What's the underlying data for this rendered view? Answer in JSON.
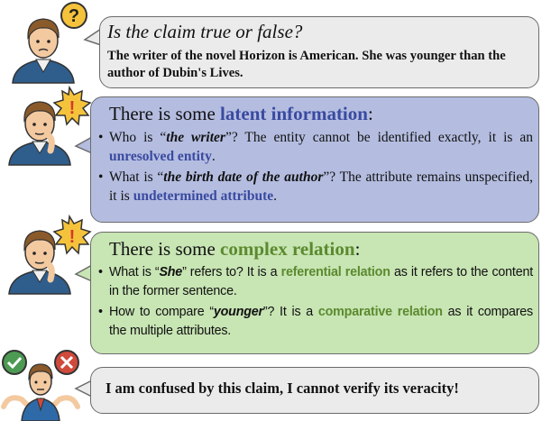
{
  "question": {
    "title": "Is the claim true or false?",
    "claim": "The writer of the novel Horizon is American. She was younger than the author of Dubin's Lives."
  },
  "latent": {
    "title_prefix": "There is some ",
    "title_highlight": "latent information",
    "title_suffix": ":",
    "items": [
      {
        "p1": "Who is “",
        "em": "the writer",
        "p2": "”? The entity cannot be identified exactly, it is an ",
        "hl": "unresolved entity",
        "p3": "."
      },
      {
        "p1": "What is “",
        "em": "the birth date of the author",
        "p2": "”? The attribute remains unspecified, it is ",
        "hl": "undetermined attribute",
        "p3": "."
      }
    ]
  },
  "complex": {
    "title_prefix": "There is some ",
    "title_highlight": "complex relation",
    "title_suffix": ":",
    "items": [
      {
        "p1": "What is “",
        "em": "She",
        "p2": "” refers to? It is a ",
        "hl": "referential relation",
        "p3": " as it refers to the content in the former sentence."
      },
      {
        "p1": "How to  compare “",
        "em": "younger",
        "p2": "”? It is a ",
        "hl": "comparative relation",
        "p3": " as it compares the multiple attributes."
      }
    ]
  },
  "conclusion": "I am confused by this claim, I cannot verify its veracity!",
  "icons": [
    "question-mark-icon",
    "exclamation-burst-icon",
    "check-icon",
    "cross-icon"
  ],
  "colors": {
    "question_bubble": "#ebebeb",
    "latent_bubble": "#b4bde0",
    "complex_bubble": "#c8e5b4",
    "latent_highlight": "#3a4aa0",
    "complex_highlight": "#5b8a2e"
  }
}
